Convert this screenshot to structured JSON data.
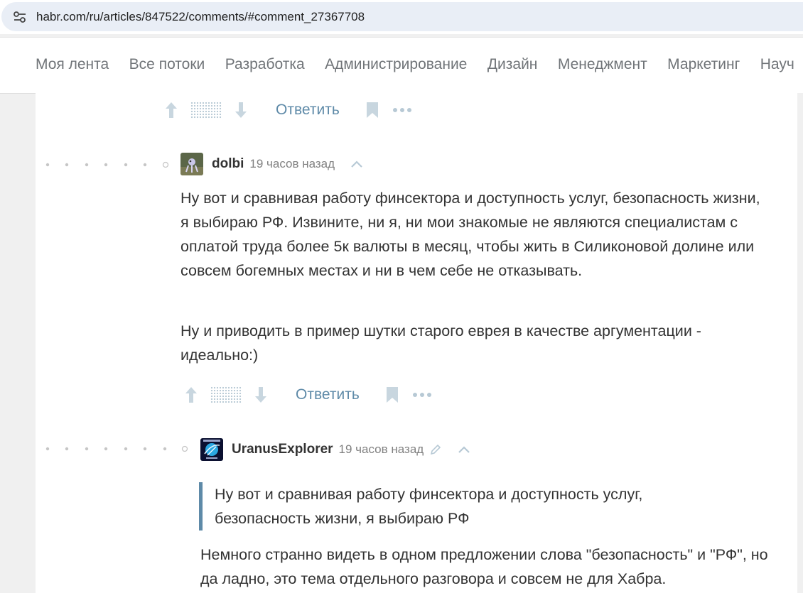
{
  "browser": {
    "url": "habr.com/ru/articles/847522/comments/#comment_27367708"
  },
  "nav": {
    "items": [
      "Моя лента",
      "Все потоки",
      "Разработка",
      "Администрирование",
      "Дизайн",
      "Менеджмент",
      "Маркетинг",
      "Науч"
    ]
  },
  "actions": {
    "reply_label": "Ответить"
  },
  "comments": [
    {
      "username": "dolbi",
      "time": "19 часов назад",
      "paragraphs": [
        "Ну вот и сравнивая работу финсектора и доступность услуг, безопасность жизни, я выбираю РФ. Извините, ни я, ни мои знакомые не являются специалистам с оплатой труда более 5к валюты в месяц, чтобы жить в Силиконовой долине или совсем богемных местах и ни в чем себе не отказывать.",
        "Ну и приводить в пример шутки старого еврея в качестве аргументации - идеально:)"
      ]
    },
    {
      "username": "UranusExplorer",
      "time": "19 часов назад",
      "quote": "Ну вот и сравнивая работу финсектора и доступность услуг, безопасность жизни, я выбираю РФ",
      "paragraphs": [
        "Немного странно видеть в одном предложении слова \"безопасность\" и \"РФ\", но да ладно, это тема отдельного разговора и совсем не для Хабра."
      ]
    }
  ],
  "colors": {
    "accent": "#5e8aa8",
    "nav_text": "#707478",
    "muted": "#808080"
  }
}
